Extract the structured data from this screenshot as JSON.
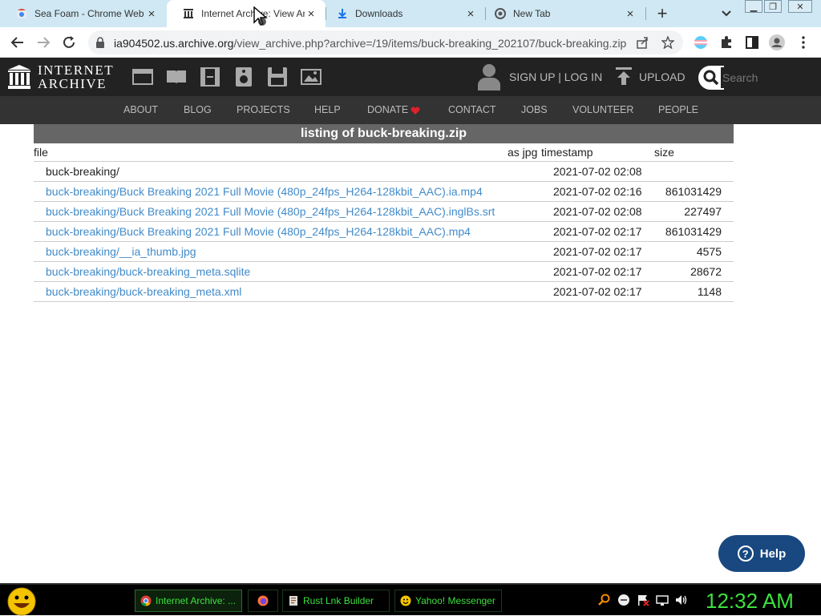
{
  "browser": {
    "tabs": [
      {
        "title": "Sea Foam - Chrome Web",
        "icon": "chrome-web-store-icon",
        "active": false
      },
      {
        "title": "Internet Archive: View Archive",
        "icon": "internet-archive-icon",
        "active": true
      },
      {
        "title": "Downloads",
        "icon": "download-icon",
        "active": false
      },
      {
        "title": "New Tab",
        "icon": "chrome-icon",
        "active": false
      }
    ],
    "url_host": "ia904502.us.archive.org",
    "url_path": "/view_archive.php?archive=/19/items/buck-breaking_202107/buck-breaking.zip"
  },
  "ia": {
    "logo_line1": "INTERNET",
    "logo_line2": "ARCHIVE",
    "signup": "SIGN UP | LOG IN",
    "upload": "UPLOAD",
    "search_placeholder": "Search",
    "nav": [
      "ABOUT",
      "BLOG",
      "PROJECTS",
      "HELP",
      "DONATE",
      "CONTACT",
      "JOBS",
      "VOLUNTEER",
      "PEOPLE"
    ]
  },
  "listing": {
    "title": "listing of buck-breaking.zip",
    "headers": {
      "file": "file",
      "as_jpg": "as jpg",
      "timestamp": "timestamp",
      "size": "size"
    },
    "rows": [
      {
        "file": "buck-breaking/",
        "link": false,
        "timestamp": "2021-07-02 02:08",
        "size": ""
      },
      {
        "file": "buck-breaking/Buck Breaking 2021 Full Movie (480p_24fps_H264-128kbit_AAC).ia.mp4",
        "link": true,
        "timestamp": "2021-07-02 02:16",
        "size": "861031429"
      },
      {
        "file": "buck-breaking/Buck Breaking 2021 Full Movie (480p_24fps_H264-128kbit_AAC).inglBs.srt",
        "link": true,
        "timestamp": "2021-07-02 02:08",
        "size": "227497"
      },
      {
        "file": "buck-breaking/Buck Breaking 2021 Full Movie (480p_24fps_H264-128kbit_AAC).mp4",
        "link": true,
        "timestamp": "2021-07-02 02:17",
        "size": "861031429"
      },
      {
        "file": "buck-breaking/__ia_thumb.jpg",
        "link": true,
        "timestamp": "2021-07-02 02:17",
        "size": "4575"
      },
      {
        "file": "buck-breaking/buck-breaking_meta.sqlite",
        "link": true,
        "timestamp": "2021-07-02 02:17",
        "size": "28672"
      },
      {
        "file": "buck-breaking/buck-breaking_meta.xml",
        "link": true,
        "timestamp": "2021-07-02 02:17",
        "size": "1148"
      }
    ]
  },
  "help_label": "Help",
  "taskbar": {
    "items": [
      {
        "label": "Internet Archive: ...",
        "icon": "chrome-icon",
        "active": true
      },
      {
        "label": "",
        "icon": "firefox-icon",
        "active": false
      },
      {
        "label": "Rust Lnk Builder",
        "icon": "document-icon",
        "active": false
      },
      {
        "label": "Yahoo! Messenger",
        "icon": "yahoo-messenger-icon",
        "active": false
      }
    ],
    "clock": "12:32 AM"
  },
  "colors": {
    "accent_link": "#428bca",
    "taskbar_text": "#3ee03e",
    "ia_header": "#222222",
    "help_button": "#194880"
  }
}
